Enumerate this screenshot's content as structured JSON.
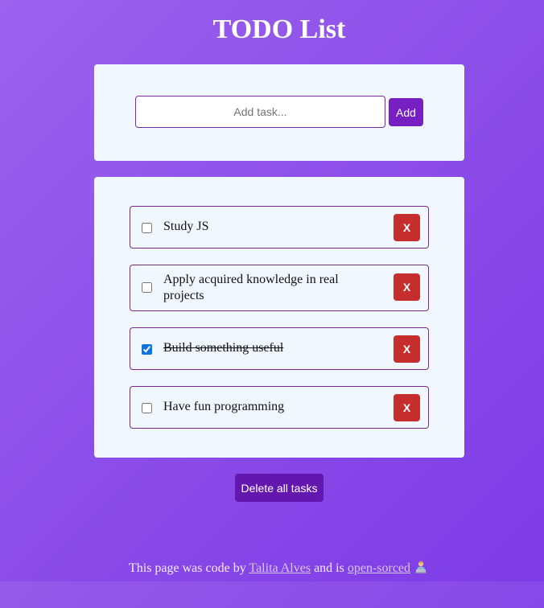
{
  "page": {
    "title": "TODO List"
  },
  "add_form": {
    "placeholder": "Add task...",
    "value": "",
    "add_label": "Add"
  },
  "tasks": [
    {
      "text": "Study JS",
      "done": false,
      "delete_label": "X"
    },
    {
      "text": "Apply acquired knowledge in real projects",
      "done": false,
      "delete_label": "X"
    },
    {
      "text": "Build something useful",
      "done": true,
      "delete_label": "X"
    },
    {
      "text": "Have fun programming",
      "done": false,
      "delete_label": "X"
    }
  ],
  "delete_all_label": "Delete all tasks",
  "footer": {
    "prefix": "This page was code by",
    "author": "Talita Alves",
    "middle": "and is",
    "link": "open-sorced",
    "emoji_icon": "person-at-laptop-icon"
  },
  "colors": {
    "accent": "#7720c2",
    "delete": "#c62e2e",
    "delete_all": "#6417ae",
    "card": "#f0f7ff"
  }
}
